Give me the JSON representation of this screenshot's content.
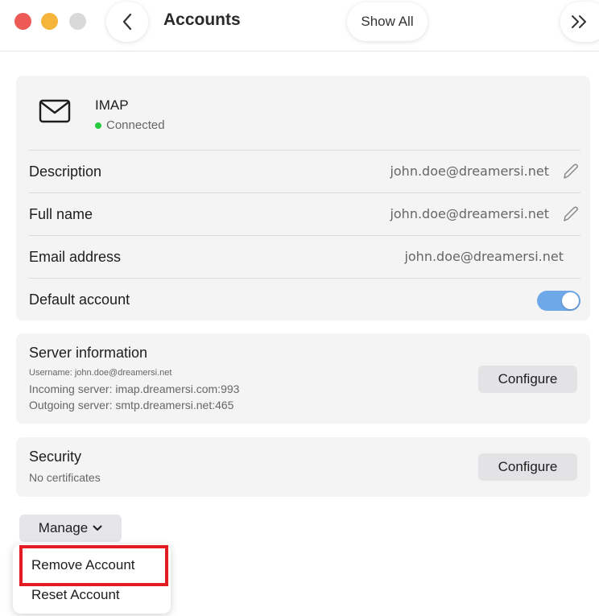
{
  "toolbar": {
    "title": "Accounts",
    "show_all_label": "Show All",
    "icons": {
      "back": "chevron-left-icon",
      "more": "double-chevron-right-icon"
    }
  },
  "account": {
    "type": "IMAP",
    "status": "Connected",
    "status_color": "#27c93f",
    "icon": "envelope-icon"
  },
  "rows": [
    {
      "label": "Description",
      "value": "john.doe@dreamersi.net",
      "editable": true
    },
    {
      "label": "Full name",
      "value": "john.doe@dreamersi.net",
      "editable": true
    },
    {
      "label": "Email address",
      "value": "john.doe@dreamersi.net",
      "editable": false
    }
  ],
  "default_account": {
    "label": "Default account",
    "enabled": true,
    "accent": "#6fa8e8"
  },
  "server": {
    "title": "Server information",
    "username": "Username: john.doe@dreamersi.net",
    "incoming": "Incoming server: imap.dreamersi.com:993",
    "outgoing": "Outgoing server: smtp.dreamersi.net:465",
    "configure_label": "Configure"
  },
  "security": {
    "title": "Security",
    "subtitle": "No certificates",
    "configure_label": "Configure"
  },
  "manage": {
    "label": "Manage",
    "menu": [
      "Remove Account",
      "Reset Account"
    ],
    "highlight_color": "#e31b23"
  }
}
